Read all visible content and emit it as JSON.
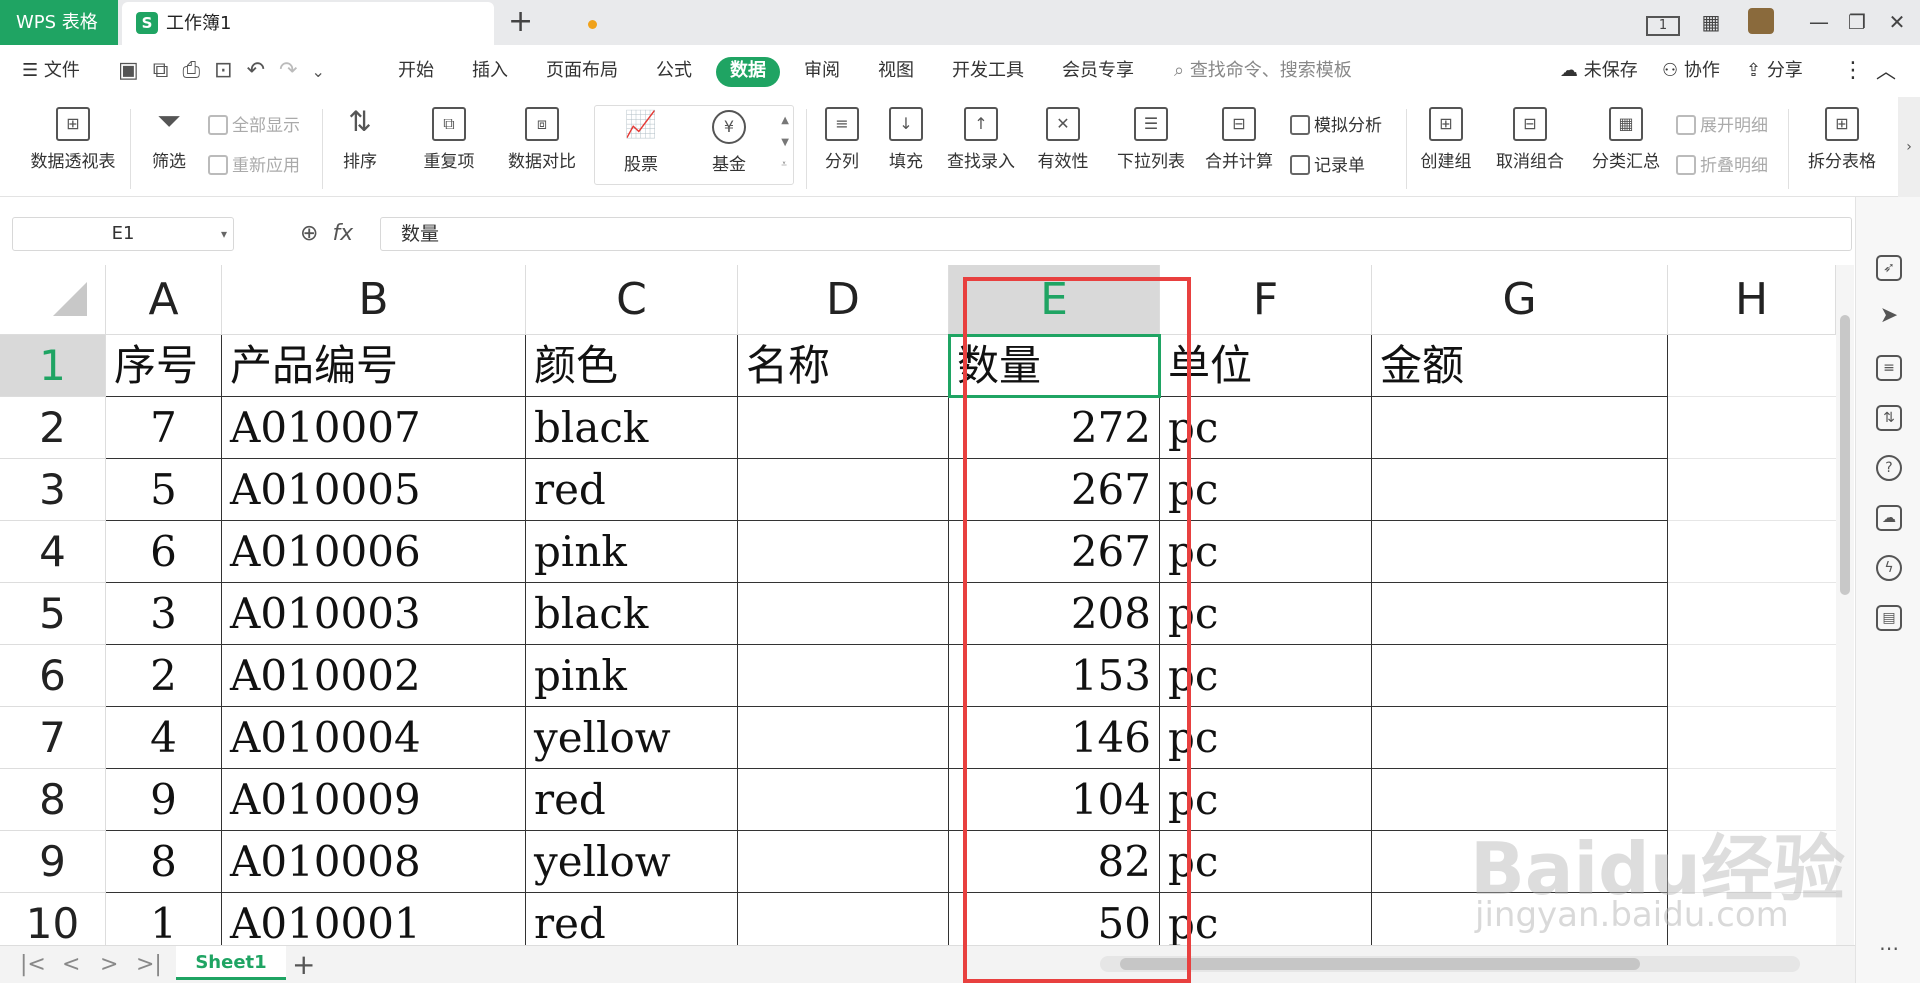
{
  "titlebar": {
    "app_tab": "WPS 表格",
    "doc_tab_icon": "S",
    "doc_tab_name": "工作簿1",
    "new_tab": "+",
    "page_indicator": "1"
  },
  "menubar": {
    "file": "文件",
    "tabs": [
      "开始",
      "插入",
      "页面布局",
      "公式",
      "数据",
      "审阅",
      "视图",
      "开发工具",
      "会员专享"
    ],
    "active_tab": "数据",
    "search": "查找命令、搜索模板",
    "unsaved": "未保存",
    "collab": "协作",
    "share": "分享"
  },
  "ribbon": {
    "pivot": "数据透视表",
    "filter": "筛选",
    "show_all": "全部显示",
    "reapply": "重新应用",
    "sort": "排序",
    "duplicates": "重复项",
    "compare": "数据对比",
    "stocks": "股票",
    "funds": "基金",
    "split": "分列",
    "fill": "填充",
    "lookup": "查找录入",
    "validity": "有效性",
    "dropdown": "下拉列表",
    "consolidate": "合并计算",
    "whatif": "模拟分析",
    "record": "记录单",
    "group": "创建组",
    "ungroup": "取消组合",
    "subtotal": "分类汇总",
    "expand": "展开明细",
    "collapse": "折叠明细",
    "split_table": "拆分表格"
  },
  "formula_bar": {
    "cell_ref": "E1",
    "fx": "fx",
    "value": "数量"
  },
  "grid": {
    "columns": [
      "A",
      "B",
      "C",
      "D",
      "E",
      "F",
      "G",
      "H"
    ],
    "rows": [
      "1",
      "2",
      "3",
      "4",
      "5",
      "6",
      "7",
      "8",
      "9",
      "10"
    ],
    "header": [
      "序号",
      "产品编号",
      "颜色",
      "名称",
      "数量",
      "单位",
      "金额"
    ],
    "data": [
      [
        "7",
        "A010007",
        "black",
        "",
        "272",
        "pc",
        ""
      ],
      [
        "5",
        "A010005",
        "red",
        "",
        "267",
        "pc",
        ""
      ],
      [
        "6",
        "A010006",
        "pink",
        "",
        "267",
        "pc",
        ""
      ],
      [
        "3",
        "A010003",
        "black",
        "",
        "208",
        "pc",
        ""
      ],
      [
        "2",
        "A010002",
        "pink",
        "",
        "153",
        "pc",
        ""
      ],
      [
        "4",
        "A010004",
        "yellow",
        "",
        "146",
        "pc",
        ""
      ],
      [
        "9",
        "A010009",
        "red",
        "",
        "104",
        "pc",
        ""
      ],
      [
        "8",
        "A010008",
        "yellow",
        "",
        "82",
        "pc",
        ""
      ],
      [
        "1",
        "A010001",
        "red",
        "",
        "50",
        "pc",
        ""
      ]
    ]
  },
  "sheetbar": {
    "sheet_name": "Sheet1",
    "add": "+"
  },
  "watermark": {
    "text": "Baidu经验",
    "sub": "jingyan.baidu.com"
  },
  "colors": {
    "accent": "#1fa463",
    "highlight_box": "#e8403f"
  }
}
